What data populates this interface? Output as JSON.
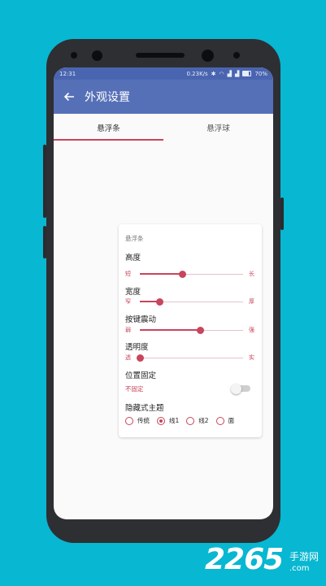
{
  "status_bar": {
    "time": "12:31",
    "network_speed": "0.23K/s",
    "battery": "70%"
  },
  "app_bar": {
    "back_icon": "arrow-left-icon",
    "title": "外观设置"
  },
  "tabs": [
    {
      "label": "悬浮条",
      "active": true
    },
    {
      "label": "悬浮球",
      "active": false
    }
  ],
  "card": {
    "section_title": "悬浮条",
    "sliders": [
      {
        "label": "高度",
        "min_label": "短",
        "max_label": "长",
        "value": 0.41
      },
      {
        "label": "宽度",
        "min_label": "窄",
        "max_label": "厚",
        "value": 0.19
      },
      {
        "label": "按键震动",
        "min_label": "弱",
        "max_label": "强",
        "value": 0.59
      },
      {
        "label": "透明度",
        "min_label": "透",
        "max_label": "实",
        "value": 0.0
      }
    ],
    "fixed_position": {
      "label": "位置固定",
      "status": "不固定",
      "enabled": false
    },
    "hidden_theme": {
      "label": "隐藏式主题",
      "options": [
        "传统",
        "线1",
        "线2",
        "面"
      ],
      "selected_index": 1
    }
  },
  "watermark": {
    "number": "2265",
    "cn": "手游网",
    "url": ".com"
  },
  "colors": {
    "accent": "#c8455b",
    "app_bar": "#5670b8",
    "background": "#08b7d1"
  }
}
